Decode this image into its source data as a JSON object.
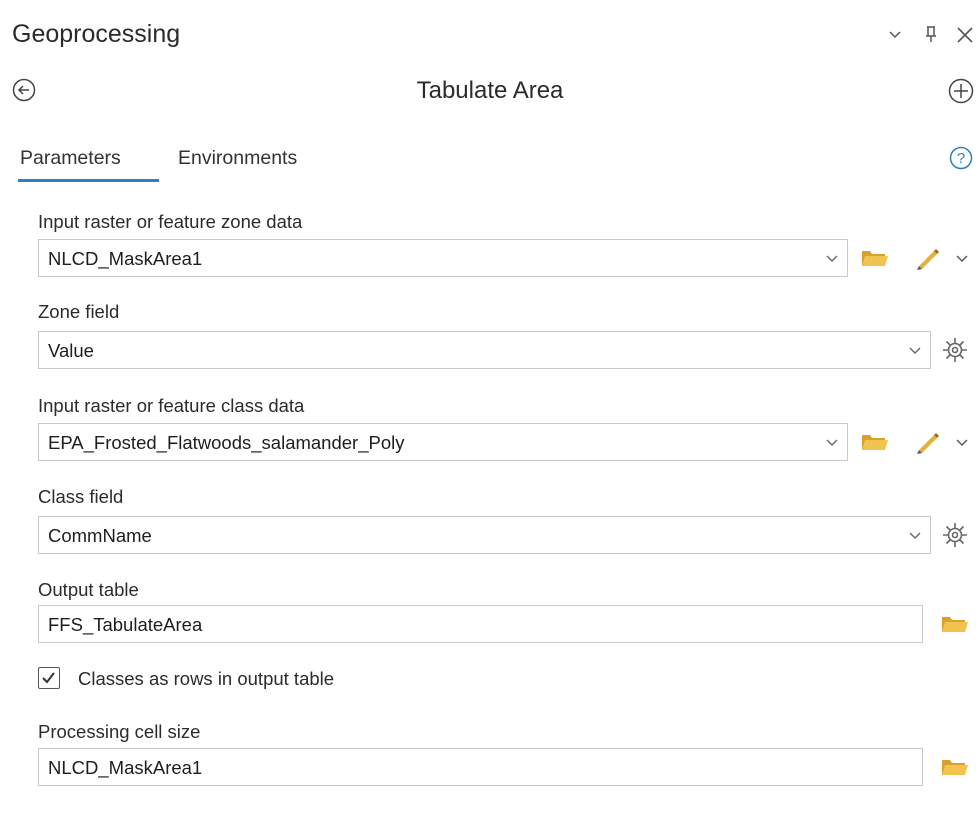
{
  "pane": {
    "title": "Geoprocessing",
    "controls": {
      "menu_icon": "chevron-down-icon",
      "pin_icon": "pin-icon",
      "close_icon": "close-icon"
    }
  },
  "tool": {
    "title": "Tabulate Area",
    "back_icon": "back-arrow-icon",
    "add_icon": "add-icon"
  },
  "tabs": [
    {
      "label": "Parameters",
      "active": true
    },
    {
      "label": "Environments",
      "active": false
    }
  ],
  "help_icon": "help-icon",
  "parameters": {
    "zone_data": {
      "label": "Input raster or feature zone data",
      "value": "NLCD_MaskArea1"
    },
    "zone_field": {
      "label": "Zone field",
      "value": "Value"
    },
    "class_data": {
      "label": "Input raster or feature class data",
      "value": "EPA_Frosted_Flatwoods_salamander_Poly"
    },
    "class_field": {
      "label": "Class field",
      "value": "CommName"
    },
    "output_table": {
      "label": "Output table",
      "value": "FFS_TabulateArea"
    },
    "classes_as_rows": {
      "label": "Classes as rows in output table",
      "checked": true
    },
    "cell_size": {
      "label": "Processing cell size",
      "value": "NLCD_MaskArea1"
    }
  },
  "colors": {
    "accent": "#2a80c3",
    "folder": "#e8b43a",
    "pencil": "#e0a82e"
  }
}
